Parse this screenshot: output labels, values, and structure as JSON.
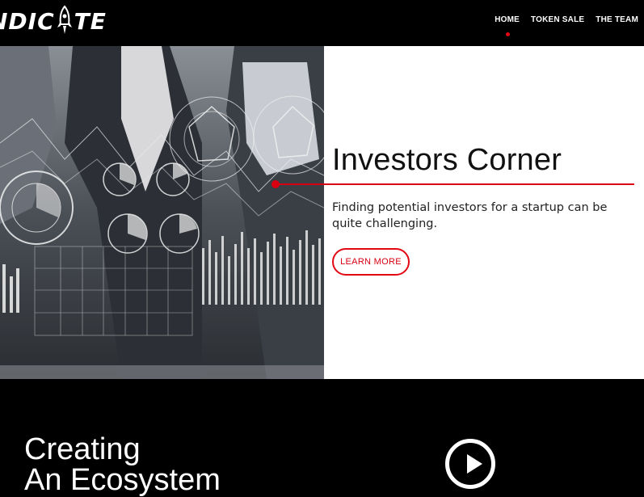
{
  "header": {
    "logo_text": "NDIC  TE",
    "nav": [
      {
        "label": "HOME",
        "active": true
      },
      {
        "label": "TOKEN SALE",
        "active": false
      },
      {
        "label": "THE TEAM",
        "active": false
      }
    ]
  },
  "hero": {
    "title": "Investors Corner",
    "description": "Finding potential investors for a startup can be quite challenging.",
    "button_label": "LEARN MORE",
    "accent_color": "#d90012"
  },
  "section2": {
    "heading_line1": "Creating",
    "heading_line2": "An Ecosystem",
    "play_icon": "play-circle-icon"
  }
}
